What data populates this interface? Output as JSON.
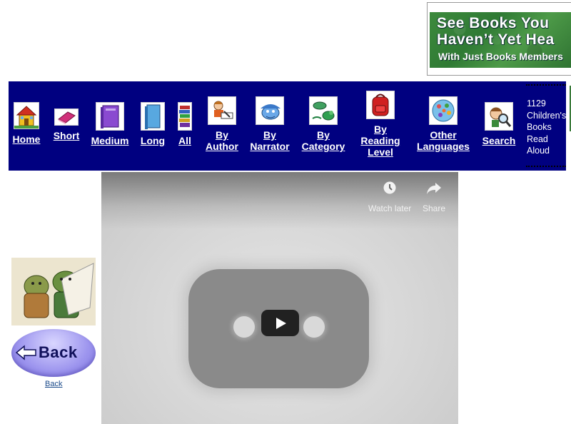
{
  "ad": {
    "line1": "See Books You",
    "line2": "Haven’t Yet Hea",
    "line3": "With Just Books Members"
  },
  "nav": {
    "items": [
      {
        "label": "Home"
      },
      {
        "label": "Short"
      },
      {
        "label": "Medium"
      },
      {
        "label": "Long"
      },
      {
        "label": "All"
      },
      {
        "label_lines": [
          "By",
          "Author"
        ]
      },
      {
        "label_lines": [
          "By",
          "Narrator"
        ]
      },
      {
        "label_lines": [
          "By",
          "Category"
        ]
      },
      {
        "label_lines": [
          "By",
          "Reading",
          "Level"
        ]
      },
      {
        "label_lines": [
          "Other",
          "Languages"
        ]
      },
      {
        "label": "Search"
      }
    ],
    "counter": [
      "1129",
      "Children's",
      "Books",
      "Read",
      "Aloud"
    ]
  },
  "video": {
    "watch_later": "Watch later",
    "share": "Share",
    "watch_later_icon": "clock-icon",
    "share_icon": "share-arrow-icon",
    "play_icon": "play-icon"
  },
  "sidebar": {
    "back_button_text": "Back",
    "back_link": "Back"
  },
  "colors": {
    "nav_background": "#000080",
    "ad_green": "#2f7a34"
  }
}
